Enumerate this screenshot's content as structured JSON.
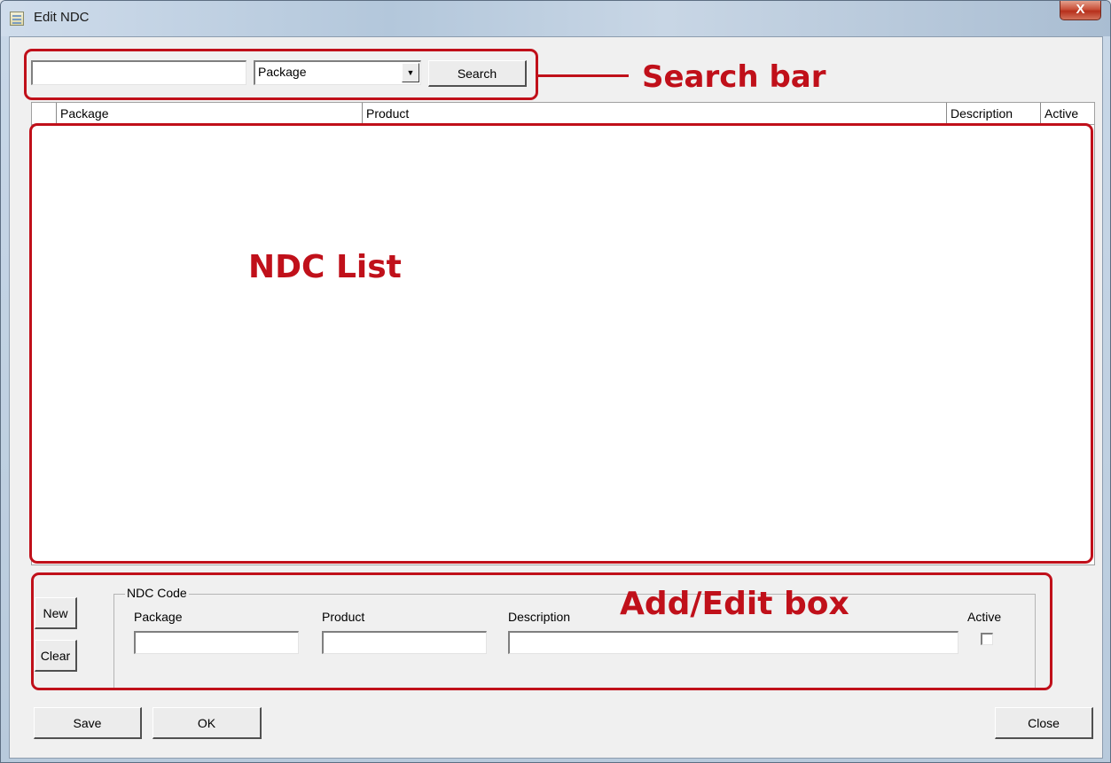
{
  "window": {
    "title": "Edit NDC",
    "close_glyph": "X"
  },
  "search": {
    "input_value": "",
    "field_selected": "Package",
    "dropdown_arrow": "▼",
    "button_label": "Search"
  },
  "list": {
    "columns": [
      "Package",
      "Product",
      "Description",
      "Active"
    ],
    "rows": []
  },
  "editor": {
    "new_label": "New",
    "clear_label": "Clear",
    "group_label": "NDC Code",
    "package_label": "Package",
    "product_label": "Product",
    "description_label": "Description",
    "active_label": "Active",
    "package_value": "",
    "product_value": "",
    "description_value": "",
    "active_checked": false
  },
  "footer": {
    "save_label": "Save",
    "ok_label": "OK",
    "close_label": "Close"
  },
  "annotations": {
    "search_bar": "Search bar",
    "ndc_list": "NDC List",
    "add_edit_box": "Add/Edit box",
    "color": "#c0101a"
  }
}
